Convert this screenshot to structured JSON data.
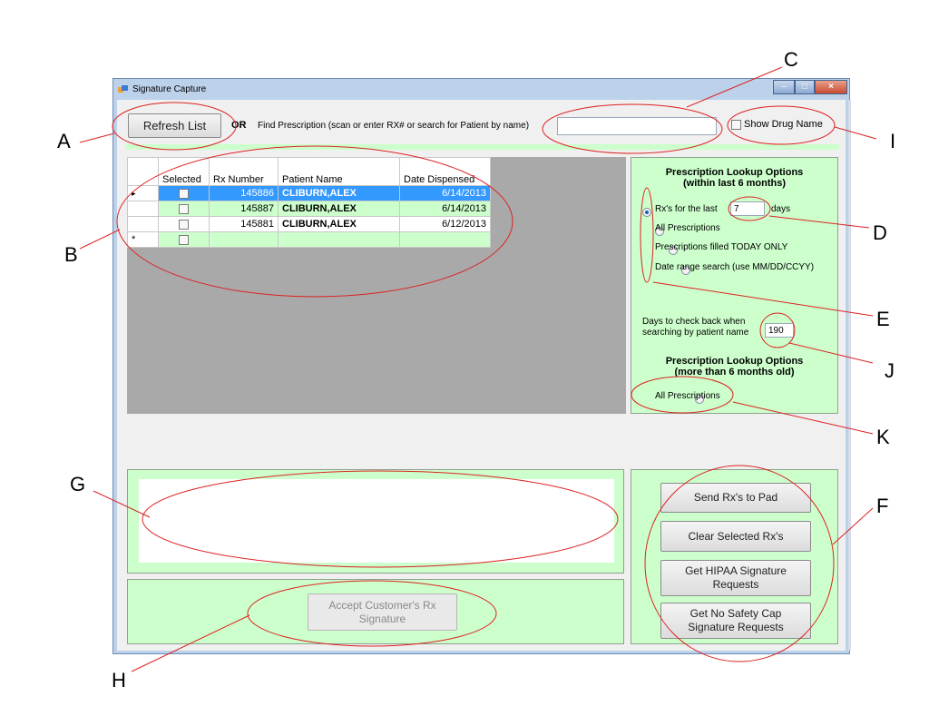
{
  "window": {
    "title": "Signature Capture"
  },
  "toolbar": {
    "refresh_label": "Refresh List",
    "or_label": "OR",
    "find_label": "Find Prescription (scan or enter RX# or search for Patient by name)",
    "search_value": "",
    "show_drug_name_label": "Show Drug Name"
  },
  "grid": {
    "columns": [
      "Selected",
      "Rx Number",
      "Patient Name",
      "Date Dispensed"
    ],
    "rows": [
      {
        "rx": "145886",
        "patient": "CLIBURN,ALEX",
        "date": "6/14/2013"
      },
      {
        "rx": "145887",
        "patient": "CLIBURN,ALEX",
        "date": "6/14/2013"
      },
      {
        "rx": "145881",
        "patient": "CLIBURN,ALEX",
        "date": "6/12/2013"
      }
    ],
    "current_row_marker": "▸",
    "new_row_marker": "*"
  },
  "lookup": {
    "title_line1": "Prescription Lookup Options",
    "title_line2": "(within last 6 months)",
    "opt_last_prefix": "Rx's for the last",
    "days_value": "7",
    "opt_last_suffix": "days",
    "opt_all": "All Prescriptions",
    "opt_today": "Prescriptions filled TODAY ONLY",
    "opt_range": "Date range search (use MM/DD/CCYY)",
    "days_back_line1": "Days to check back when",
    "days_back_line2": "searching by patient name",
    "days_back_value": "190",
    "old_title_line1": "Prescription Lookup Options",
    "old_title_line2": "(more than 6 months old)",
    "old_opt_all": "All Prescriptions"
  },
  "actions": {
    "send": "Send Rx's to Pad",
    "clear": "Clear Selected Rx's",
    "hipaa_1": "Get HIPAA Signature",
    "hipaa_2": "Requests",
    "safety_1": "Get No Safety Cap",
    "safety_2": "Signature Requests",
    "accept_1": "Accept Customer's Rx",
    "accept_2": "Signature"
  },
  "callouts": [
    "A",
    "B",
    "C",
    "D",
    "E",
    "F",
    "G",
    "H",
    "I",
    "J",
    "K"
  ],
  "colors": {
    "panel_green": "#ccffcc",
    "selection_blue": "#3399ff",
    "annotation_red": "#dd2222"
  }
}
